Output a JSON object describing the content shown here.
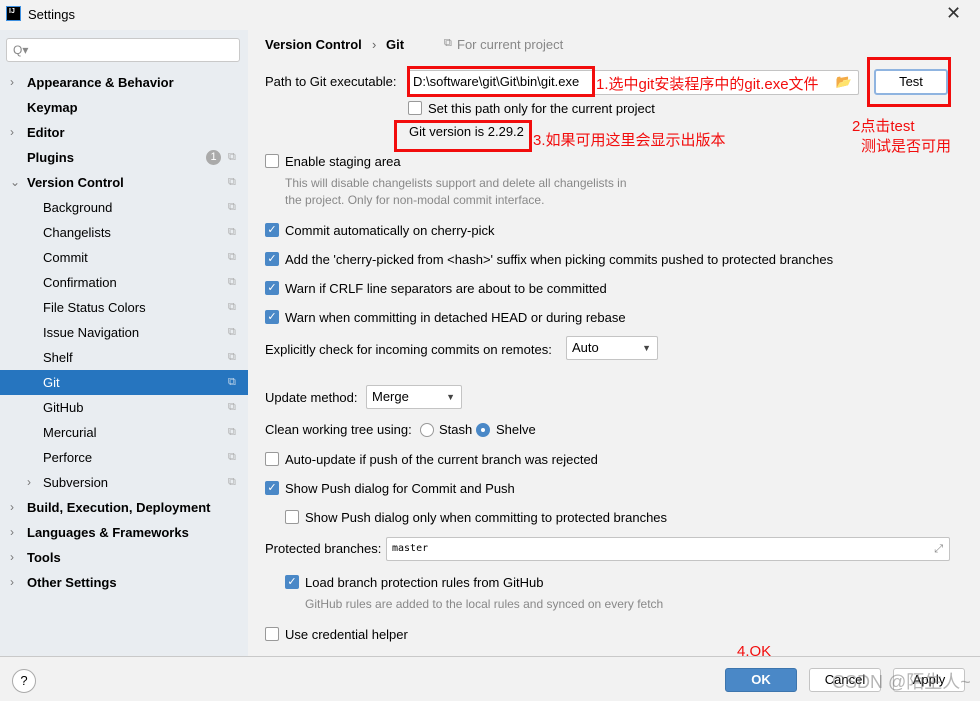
{
  "window": {
    "title": "Settings",
    "close": "✕"
  },
  "sidebar": {
    "search_placeholder": "Q▾",
    "items": [
      {
        "label": "Appearance & Behavior",
        "level": "top",
        "arrow": "›"
      },
      {
        "label": "Keymap",
        "level": "top",
        "arrow": ""
      },
      {
        "label": "Editor",
        "level": "top",
        "arrow": "›"
      },
      {
        "label": "Plugins",
        "level": "top",
        "arrow": "",
        "badge": "1"
      },
      {
        "label": "Version Control",
        "level": "top",
        "arrow": "⌄"
      },
      {
        "label": "Background",
        "level": "sub"
      },
      {
        "label": "Changelists",
        "level": "sub"
      },
      {
        "label": "Commit",
        "level": "sub"
      },
      {
        "label": "Confirmation",
        "level": "sub"
      },
      {
        "label": "File Status Colors",
        "level": "sub"
      },
      {
        "label": "Issue Navigation",
        "level": "sub"
      },
      {
        "label": "Shelf",
        "level": "sub"
      },
      {
        "label": "Git",
        "level": "sub",
        "selected": true
      },
      {
        "label": "GitHub",
        "level": "sub"
      },
      {
        "label": "Mercurial",
        "level": "sub"
      },
      {
        "label": "Perforce",
        "level": "sub"
      },
      {
        "label": "Subversion",
        "level": "sub",
        "arrow": "›"
      },
      {
        "label": "Build, Execution, Deployment",
        "level": "top",
        "arrow": "›"
      },
      {
        "label": "Languages & Frameworks",
        "level": "top",
        "arrow": "›"
      },
      {
        "label": "Tools",
        "level": "top",
        "arrow": "›"
      },
      {
        "label": "Other Settings",
        "level": "top",
        "arrow": "›"
      }
    ]
  },
  "breadcrumb": {
    "parent": "Version Control",
    "sep": "›",
    "current": "Git",
    "scope": "For current project"
  },
  "git": {
    "path_label": "Path to Git executable:",
    "path_value": "D:\\software\\git\\Git\\bin\\git.exe",
    "test": "Test",
    "current_project_only": "Set this path only for the current project",
    "version": "Git version is 2.29.2",
    "staging": "Enable staging area",
    "staging_desc1": "This will disable changelists support and delete all changelists in",
    "staging_desc2": "the project. Only for non-modal commit interface.",
    "cherry_commit": "Commit automatically on cherry-pick",
    "cherry_suffix": "Add the 'cherry-picked from <hash>' suffix when picking commits pushed to protected branches",
    "crlf": "Warn if CRLF line separators are about to be committed",
    "detached": "Warn when committing in detached HEAD or during rebase",
    "incoming_label": "Explicitly check for incoming commits on remotes:",
    "incoming_value": "Auto",
    "update_label": "Update method:",
    "update_value": "Merge",
    "clean_label": "Clean working tree using:",
    "stash": "Stash",
    "shelve": "Shelve",
    "auto_update": "Auto-update if push of the current branch was rejected",
    "push_dialog": "Show Push dialog for Commit and Push",
    "push_dialog_protected": "Show Push dialog only when committing to protected branches",
    "protected_label": "Protected branches:",
    "protected_value": "master",
    "load_rules": "Load branch protection rules from GitHub",
    "load_rules_desc": "GitHub rules are added to the local rules and synced on every fetch",
    "credential": "Use credential helper"
  },
  "annotations": {
    "a1": "1.选中git安装程序中的git.exe文件",
    "a2a": "2点击test",
    "a2b": "测试是否可用",
    "a3": "3.如果可用这里会显示出版本",
    "a4": "4.OK",
    "color": "#f20d0d"
  },
  "footer": {
    "help": "?",
    "ok": "OK",
    "cancel": "Cancel",
    "apply": "Apply"
  },
  "watermark": "CSDN @陌生人~",
  "colors": {
    "accent": "#2675bf",
    "ok_button": "#4a88c7"
  }
}
